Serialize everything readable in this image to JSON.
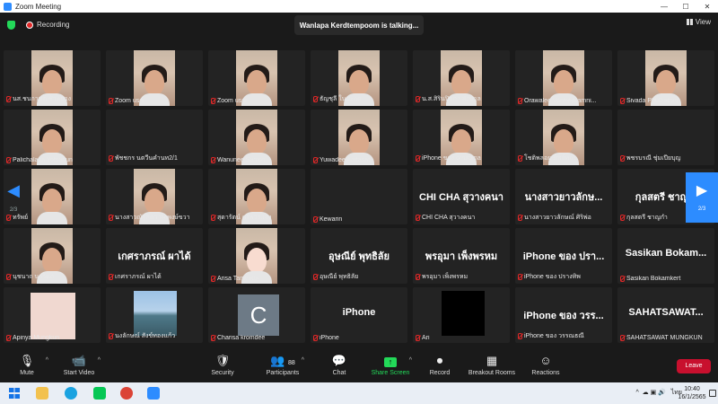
{
  "window": {
    "title": "Zoom Meeting",
    "minimize": "—",
    "maximize": "☐",
    "close": "✕"
  },
  "topbar": {
    "recording_label": "Recording",
    "talking_banner": "Wanlapa Kerdtempoom is talking...",
    "view_label": "View"
  },
  "nav": {
    "left_page": "2/3",
    "right_page": "2/3",
    "left_arrow": "◀",
    "right_arrow": "▶"
  },
  "participants": [
    {
      "name": "นส.ชนกานต์ ชัวหยอง",
      "type": "video"
    },
    {
      "name": "Zoom user",
      "type": "video"
    },
    {
      "name": "Zoom user",
      "type": "video"
    },
    {
      "name": "ธัญชุลี ในมะกด",
      "type": "video"
    },
    {
      "name": "น.ส.สิรินปิยภา สังขกุล",
      "type": "video"
    },
    {
      "name": "Orawalee Vontreesamni...",
      "type": "video"
    },
    {
      "name": "Sivada Phuthaban",
      "type": "video"
    },
    {
      "name": "Palichalapa Yotsapun",
      "type": "video"
    },
    {
      "name": "พัชชกร นตวีนคำนท2/1",
      "type": "blank"
    },
    {
      "name": "Wanunee Samon",
      "type": "video"
    },
    {
      "name": "Yuwadee Aattasat",
      "type": "video"
    },
    {
      "name": "iPhone ของ ornapma",
      "type": "video"
    },
    {
      "name": "โชติพลอย ทิพย์ทอง",
      "type": "video"
    },
    {
      "name": "พชรบรณี ชุ่มเปียบุญ",
      "type": "blank"
    },
    {
      "name": "ทรัพย์",
      "type": "video"
    },
    {
      "name": "นางสาวณัฐสิดา พลพงษ์ขวา",
      "type": "video"
    },
    {
      "name": "สุดารัตน์ ศรีพวงเเสง",
      "type": "video"
    },
    {
      "name": "Kewarin",
      "type": "blank"
    },
    {
      "name": "CHI CHA สุวางคนา",
      "type": "text",
      "big": "CHI CHA สุวางคนา"
    },
    {
      "name": "นางสาวยาวลักษณ์ ศิริพ่อ",
      "type": "text",
      "big": "นางสาวยาวลักษ..."
    },
    {
      "name": "กุลสตรี ชาญกำ",
      "type": "text",
      "big": "กุลสตรี ชาญ..."
    },
    {
      "name": "นุชนาถ นาวินศ",
      "type": "video"
    },
    {
      "name": "เกศราภรณ์ ผาได้",
      "type": "text",
      "big": "เกศราภรณ์ ผาได้"
    },
    {
      "name": "Arisa Tamthida",
      "type": "anime"
    },
    {
      "name": "อุษณีย์ พุทธิลัย",
      "type": "text",
      "big": "อุษณีย์ พุทธิลัย"
    },
    {
      "name": "พรอุมา เพ็งพรหม",
      "type": "text",
      "big": "พรอุมา เพ็งพรหม"
    },
    {
      "name": "iPhone ของ ปรางทิพ",
      "type": "text",
      "big": "iPhone ของ ปรา..."
    },
    {
      "name": "Sasikan Bokamkert",
      "type": "text",
      "big": "Sasikan Bokam..."
    },
    {
      "name": "Apinya Mungkun",
      "type": "pink"
    },
    {
      "name": "นงลักษณ์ สังข์ทองแก้ว",
      "type": "lake"
    },
    {
      "name": "Charisa kromdee",
      "type": "avatar",
      "initial": "C"
    },
    {
      "name": "iPhone",
      "type": "text",
      "big": "iPhone"
    },
    {
      "name": "Ari",
      "type": "black"
    },
    {
      "name": "iPhone ของ วรรณธณี",
      "type": "text",
      "big": "iPhone ของ วรร..."
    },
    {
      "name": "SAHATSAWAT MUNGKUN",
      "type": "text",
      "big": "SAHATSAWAT..."
    }
  ],
  "toolbar": {
    "mute": "Mute",
    "start_video": "Start Video",
    "security": "Security",
    "participants": "Participants",
    "participants_count": "88",
    "chat": "Chat",
    "share_screen": "Share Screen",
    "record": "Record",
    "breakout_rooms": "Breakout Rooms",
    "reactions": "Reactions",
    "leave": "Leave"
  },
  "taskbar": {
    "time": "10:40",
    "date": "16/1/2565",
    "lang": "ไทย",
    "tray_caret": "^"
  },
  "colors": {
    "accent": "#2d8cff",
    "leave": "#c8102e",
    "share": "#23d959",
    "record": "#e02828"
  }
}
